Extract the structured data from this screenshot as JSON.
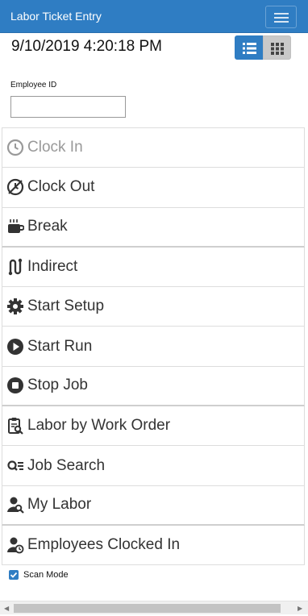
{
  "header": {
    "title": "Labor Ticket Entry",
    "menu_icon": "hamburger-icon"
  },
  "datetime": "9/10/2019 4:20:18 PM",
  "view_toggle": {
    "active": "list",
    "icons": [
      "list-icon",
      "grid-icon"
    ]
  },
  "employee": {
    "label": "Employee ID",
    "value": "",
    "placeholder": ""
  },
  "actions": [
    {
      "label": "Clock In",
      "icon": "clock-icon",
      "enabled": false
    },
    {
      "label": "Clock Out",
      "icon": "clock-off-icon",
      "enabled": true
    },
    {
      "label": "Break",
      "icon": "coffee-icon",
      "enabled": true
    },
    {
      "label": "Indirect",
      "icon": "indirect-icon",
      "enabled": true
    },
    {
      "label": "Start Setup",
      "icon": "gear-icon",
      "enabled": true
    },
    {
      "label": "Start Run",
      "icon": "play-icon",
      "enabled": true
    },
    {
      "label": "Stop Job",
      "icon": "stop-icon",
      "enabled": true
    },
    {
      "label": "Labor by Work Order",
      "icon": "clipboard-search-icon",
      "enabled": true
    },
    {
      "label": "Job Search",
      "icon": "search-list-icon",
      "enabled": true
    },
    {
      "label": "My Labor",
      "icon": "user-search-icon",
      "enabled": true
    },
    {
      "label": "Employees Clocked In",
      "icon": "user-clock-icon",
      "enabled": true
    }
  ],
  "scan_mode": {
    "label": "Scan Mode",
    "checked": true
  },
  "colors": {
    "accent": "#2f7dc3",
    "text": "#333333",
    "disabled": "#999999"
  }
}
